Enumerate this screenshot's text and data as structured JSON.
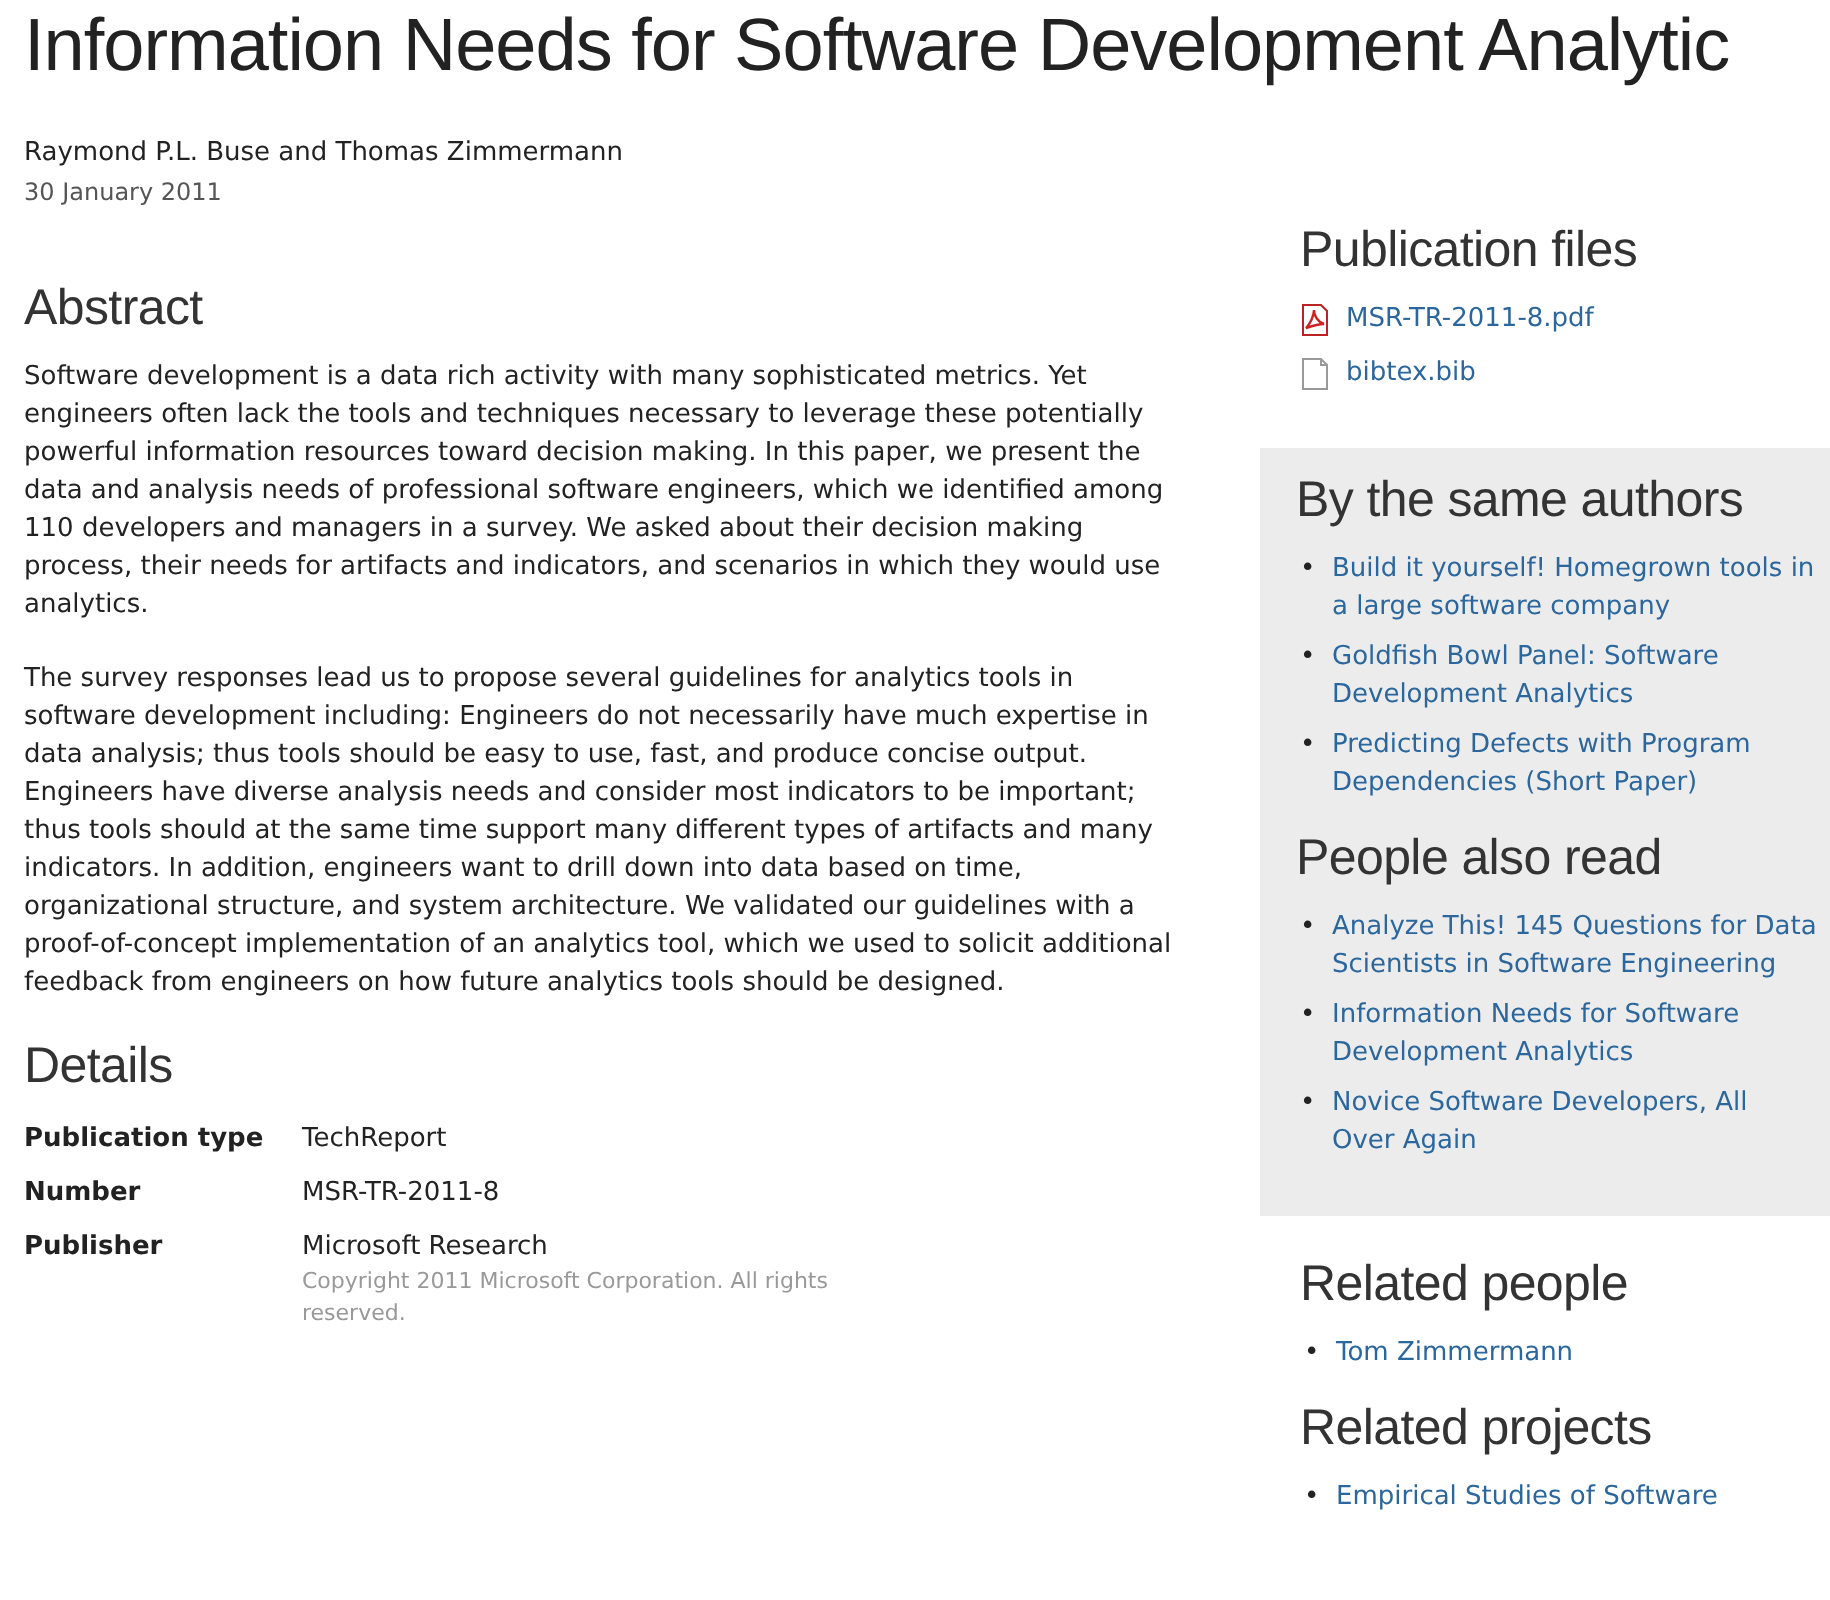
{
  "title": "Information Needs for Software Development Analytic",
  "authors": "Raymond P.L. Buse and Thomas Zimmermann",
  "date": "30 January 2011",
  "abstract": {
    "heading": "Abstract",
    "paragraphs": [
      "Software development is a data rich activity with many sophisticated metrics. Yet engineers often lack the tools and techniques necessary to leverage these potentially powerful information resources toward decision making. In this paper, we present the data and analysis needs of professional software engineers, which we identified among 110 developers and managers in a survey. We asked about their decision making process, their needs for artifacts and indicators, and scenarios in which they would use analytics.",
      "The survey responses lead us to propose several guidelines for analytics tools in software development including: Engineers do not necessarily have much expertise in data analysis; thus tools should be easy to use, fast, and produce concise output. Engineers have diverse analysis needs and consider most indicators to be important; thus tools should at the same time support many different types of artifacts and many indicators. In addition, engineers want to drill down into data based on time, organizational structure, and system architecture. We validated our guidelines with a proof-of-concept implementation of an analytics tool, which we used to solicit additional feedback from engineers on how future analytics tools should be designed."
    ]
  },
  "details": {
    "heading": "Details",
    "rows": [
      {
        "label": "Publication type",
        "value": "TechReport"
      },
      {
        "label": "Number",
        "value": "MSR-TR-2011-8"
      },
      {
        "label": "Publisher",
        "value": "Microsoft Research",
        "note": "Copyright 2011 Microsoft Corporation. All rights reserved."
      }
    ]
  },
  "sidebar": [
    {
      "sections": [
        {
          "heading": "Publication files",
          "files": [
            {
              "name": "MSR-TR-2011-8.pdf",
              "kind": "pdf"
            },
            {
              "name": "bibtex.bib",
              "kind": "file"
            }
          ]
        }
      ]
    },
    {
      "shaded": true,
      "sections": [
        {
          "heading": "By the same authors",
          "bullet": "•",
          "links": [
            "Build it yourself! Homegrown tools in a large software company",
            "Goldfish Bowl Panel: Software Development Analytics",
            "Predicting Defects with Program Dependencies (Short Paper)"
          ]
        },
        {
          "heading": "People also read",
          "bullet": "•",
          "links": [
            "Analyze This! 145 Questions for Data Scientists in Software Engineering",
            "Information Needs for Software Development Analytics",
            "Novice Software Developers, All Over Again"
          ]
        }
      ]
    },
    {
      "sections": [
        {
          "heading": "Related people",
          "bullet": "•",
          "links": [
            "Tom Zimmermann"
          ]
        },
        {
          "heading": "Related projects",
          "bullet": "•",
          "links": [
            "Empirical Studies of Software"
          ]
        }
      ]
    }
  ]
}
